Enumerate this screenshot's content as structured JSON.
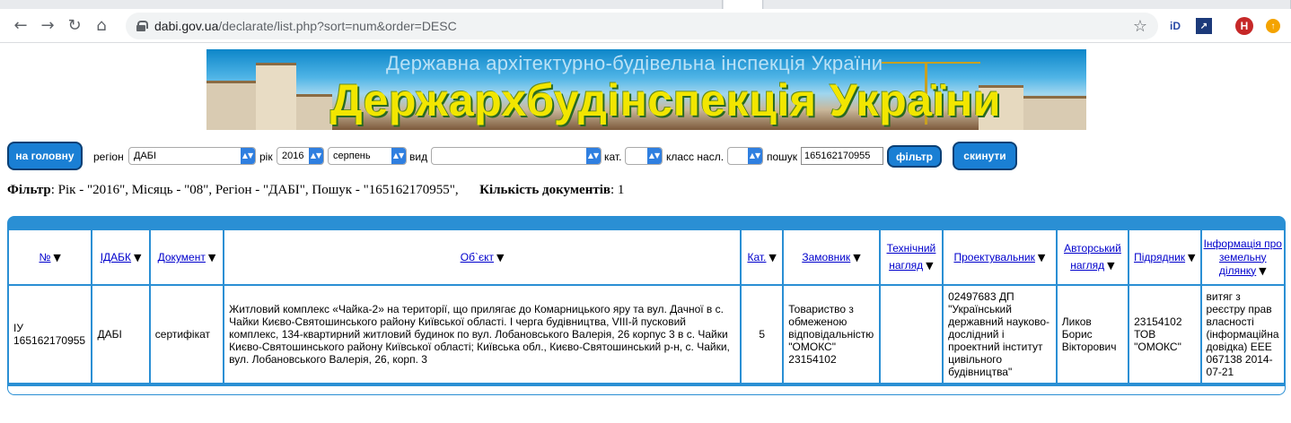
{
  "browser": {
    "url_host": "dabi.gov.ua",
    "url_path": "/declarate/list.php?sort=num&order=DESC",
    "ext_profile_letter": "Н"
  },
  "banner": {
    "subtitle": "Державна архітектурно-будівельна інспекція України",
    "title": "Держархбудінспекція України"
  },
  "filterbar": {
    "home_button": "на головну",
    "region_label": "регіон",
    "region_value": "ДАБІ",
    "year_label": "рік",
    "year_value": "2016",
    "month_value": "серпень",
    "type_label": "вид",
    "type_value": "",
    "cat_label": "кат.",
    "cat_value": "",
    "class_label": "класс насл.",
    "class_value": "",
    "search_label": "пошук",
    "search_value": "165162170955",
    "filter_button": "фільтр",
    "reset_button": "скинути"
  },
  "summary": {
    "filter_label": "Фільтр",
    "filter_text": ": Рік - \"2016\", Місяць - \"08\", Регіон - \"ДАБІ\", Пошук - \"165162170955\",",
    "count_label": "Кількість документів",
    "count_value": ": 1"
  },
  "table": {
    "headers": [
      "№",
      "ІДАБК",
      "Документ",
      "Об`єкт",
      "Кат.",
      "Замовник",
      "Технічний нагляд",
      "Проектувальник",
      "Авторський нагляд",
      "Підрядник",
      "Інформація про земельну ділянку"
    ],
    "rows": [
      {
        "num": "ІУ 165162170955",
        "idabk": "ДАБІ",
        "document": "сертифікат",
        "object": "Житловий комплекс «Чайка-2» на території, що прилягає до Комарницького яру та вул. Дачної в с. Чайки Києво-Святошинського району Київської області. I черга будівництва, VIII-й пусковий комплекс, 134-квартирний житловий будинок по вул. Лобановського Валерія, 26 корпус 3 в с. Чайки Києво-Святошинського району Київської області; Київська обл., Києво-Святошинський р-н, с. Чайки, вул. Лобановського Валерія, 26, корп. 3",
        "cat": "5",
        "customer": "Товариство з обмеженою відповідальністю \"ОМОКС\" 23154102",
        "tech_supervision": "",
        "designer": "02497683 ДП \"Український державний науково-дослідний і проектний інститут цивільного будівництва\"",
        "author_supervision": "Ликов Борис Вікторович",
        "contractor": "23154102 ТОВ \"ОМОКС\"",
        "land_info": "витяг з реєстру прав власності (інформаційна довідка) ЕЕЕ 067138 2014-07-21"
      }
    ]
  }
}
